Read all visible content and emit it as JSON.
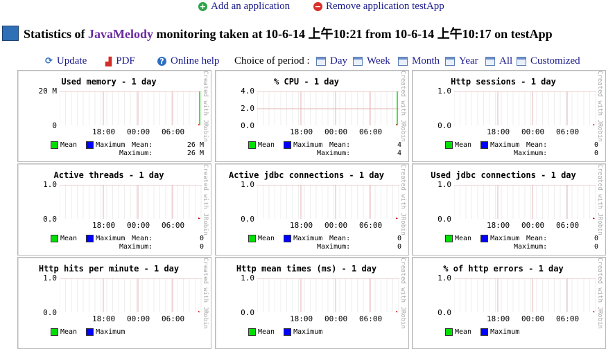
{
  "top": {
    "add_label": "Add an application",
    "remove_label": "Remove application testApp"
  },
  "header": {
    "prefix": "Statistics of ",
    "brand": "JavaMelody",
    "suffix": " monitoring taken at 10-6-14 上午10:21 from 10-6-14 上午10:17 on testApp"
  },
  "toolbar": {
    "update": "Update",
    "pdf": "PDF",
    "help": "Online help",
    "period_label": "Choice of period :",
    "periods": [
      "Day",
      "Week",
      "Month",
      "Year",
      "All",
      "Customized"
    ]
  },
  "legend": {
    "mean": "Mean",
    "maximum": "Maximum",
    "mean_stat": "Mean:",
    "max_stat": "Maximum:"
  },
  "vertical_text": "Created with JRobin",
  "x_ticks": [
    "18:00",
    "00:00",
    "06:00"
  ],
  "colors": {
    "mean": "#00e000",
    "maximum": "#0000ff",
    "link": "#1a1a8c",
    "brand": "#6a2ba0",
    "grid": "#e6b3b3",
    "minor_grid": "#eeeeee"
  },
  "charts": [
    {
      "title": "Used memory - 1 day",
      "y_ticks": [
        "20 M",
        "0"
      ],
      "mean": "26 M",
      "maximum": "26 M",
      "spike": 1
    },
    {
      "title": "% CPU - 1 day",
      "y_ticks": [
        "4.0",
        "2.0",
        "0.0"
      ],
      "mean": "4",
      "maximum": "4",
      "spike": 1
    },
    {
      "title": "Http sessions - 1 day",
      "y_ticks": [
        "1.0",
        "0.0"
      ],
      "mean": "0",
      "maximum": "0",
      "spike": 0
    },
    {
      "title": "Active threads - 1 day",
      "y_ticks": [
        "1.0",
        "0.0"
      ],
      "mean": "0",
      "maximum": "0",
      "spike": 0
    },
    {
      "title": "Active jdbc connections - 1 day",
      "y_ticks": [
        "1.0",
        "0.0"
      ],
      "mean": "0",
      "maximum": "0",
      "spike": 0
    },
    {
      "title": "Used jdbc connections - 1 day",
      "y_ticks": [
        "1.0",
        "0.0"
      ],
      "mean": "0",
      "maximum": "0",
      "spike": 0
    },
    {
      "title": "Http hits per minute - 1 day",
      "y_ticks": [
        "1.0",
        "0.0"
      ],
      "mean": "",
      "maximum": "",
      "spike": 0
    },
    {
      "title": "Http mean times (ms) - 1 day",
      "y_ticks": [
        "1.0",
        "0.0"
      ],
      "mean": "",
      "maximum": "",
      "spike": 0
    },
    {
      "title": "% of http errors - 1 day",
      "y_ticks": [
        "1.0",
        "0.0"
      ],
      "mean": "",
      "maximum": "",
      "spike": 0
    }
  ]
}
